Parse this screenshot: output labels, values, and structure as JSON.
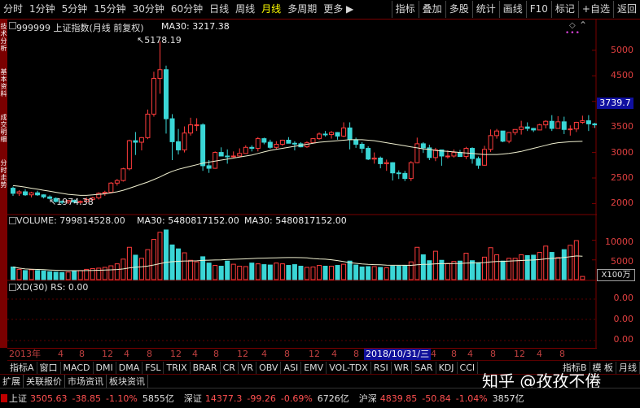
{
  "toolbar": {
    "periods": [
      "分时",
      "1分钟",
      "5分钟",
      "15分钟",
      "30分钟",
      "60分钟",
      "日线",
      "周线",
      "月线",
      "多周期",
      "更多 ▶"
    ],
    "active_period": "月线",
    "tools": [
      "指标",
      "叠加",
      "多股",
      "统计",
      "画线",
      "F10",
      "标记",
      "+自选",
      "返回"
    ]
  },
  "left_tabs": [
    "技术分析",
    "基本资料",
    "成交明细",
    "分时走势"
  ],
  "price_panel": {
    "title_code": "999999 上证指数(月线 前复权)",
    "ma_label": "MA30: 3217.38",
    "high_label": "5178.19",
    "low_label": "1974.38",
    "axis_labels": [
      "5000",
      "4500",
      "4000",
      "3500",
      "3000",
      "2500",
      "2000"
    ],
    "current_price": "3739.7",
    "colors": {
      "up": "#ff3c3c",
      "down": "#3ad6d6",
      "ma": "#f0f0d0"
    }
  },
  "volume_panel": {
    "title": "VOLUME: 799814528.00",
    "ma_label": "MA30: 5480817152.00",
    "ma_label2": "MA30: 5480817152.00",
    "axis_labels": [
      "10000",
      "5000"
    ],
    "unit": "X100万"
  },
  "xd_panel": {
    "title": "XD(30)  RS: 0.00",
    "axis_labels": [
      "0.00",
      "0.00",
      "0.00"
    ]
  },
  "time_axis": {
    "labels": [
      "2013年",
      "4",
      "8",
      "12",
      "4",
      "8",
      "12",
      "4",
      "8",
      "12",
      "4",
      "8",
      "12",
      "4",
      "8",
      "12",
      "4",
      "8",
      "",
      "4",
      "8",
      "12",
      "4",
      "8"
    ],
    "selected": "2018/10/31/三"
  },
  "indicators": [
    "指标A",
    "窗口",
    "MACD",
    "DMI",
    "DMA",
    "FSL",
    "TRIX",
    "BRAR",
    "CR",
    "VR",
    "OBV",
    "ASI",
    "EMV",
    "VOL-TDX",
    "RSI",
    "WR",
    "SAR",
    "KDJ",
    "CCI"
  ],
  "indicators_right": [
    "指标B",
    "模 板",
    "月线"
  ],
  "bottom_tabs": [
    "扩展",
    "关联报价",
    "市场资讯",
    "板块资讯"
  ],
  "watermark": "知乎 @孜孜不倦",
  "status": [
    {
      "name": "上证",
      "price": "3505.63",
      "chg": "-38.85",
      "pct": "-1.10%",
      "amt": "5855亿"
    },
    {
      "name": "深证",
      "price": "14377.3",
      "chg": "-99.26",
      "pct": "-0.69%",
      "amt": "6726亿"
    },
    {
      "name": "沪深",
      "price": "4839.85",
      "chg": "-50.84",
      "pct": "-1.04%",
      "amt": "3857亿"
    }
  ],
  "chart_data": {
    "type": "candlestick",
    "note_series": "monthly OHLC, Shanghai Composite",
    "ohlc": [
      [
        2300,
        2330,
        2150,
        2200
      ],
      [
        2200,
        2260,
        2150,
        2230
      ],
      [
        2230,
        2280,
        2150,
        2170
      ],
      [
        2170,
        2230,
        2120,
        2210
      ],
      [
        2210,
        2250,
        2150,
        2170
      ],
      [
        2170,
        2180,
        2100,
        2130
      ],
      [
        2130,
        2160,
        2080,
        2100
      ],
      [
        2100,
        2120,
        2020,
        2040
      ],
      [
        2040,
        2060,
        1990,
        2030
      ],
      [
        2030,
        2070,
        1990,
        2060
      ],
      [
        2060,
        2080,
        2000,
        2030
      ],
      [
        2030,
        2060,
        1990,
        2040
      ],
      [
        2040,
        2120,
        2000,
        2080
      ],
      [
        2080,
        2130,
        2050,
        2110
      ],
      [
        2110,
        2220,
        2080,
        2200
      ],
      [
        2200,
        2250,
        2150,
        2220
      ],
      [
        2220,
        2420,
        2200,
        2400
      ],
      [
        2400,
        2480,
        2350,
        2450
      ],
      [
        2450,
        2700,
        2430,
        2680
      ],
      [
        2680,
        3250,
        2650,
        3230
      ],
      [
        3230,
        3400,
        2950,
        3200
      ],
      [
        3200,
        3300,
        3040,
        3290
      ],
      [
        3290,
        3840,
        3260,
        3750
      ],
      [
        3750,
        4580,
        3700,
        4450
      ],
      [
        4450,
        5178,
        4150,
        4620
      ],
      [
        4620,
        4700,
        3370,
        3660
      ],
      [
        3660,
        3750,
        2850,
        3210
      ],
      [
        3210,
        3460,
        2960,
        3050
      ],
      [
        3050,
        3510,
        3000,
        3380
      ],
      [
        3380,
        3680,
        3330,
        3540
      ],
      [
        3540,
        3670,
        3420,
        3540
      ],
      [
        3540,
        3570,
        2640,
        2740
      ],
      [
        2740,
        2850,
        2600,
        2690
      ],
      [
        2690,
        3020,
        2680,
        3000
      ],
      [
        3000,
        3100,
        2950,
        2930
      ],
      [
        2930,
        3060,
        2780,
        2920
      ],
      [
        2920,
        3020,
        2900,
        2930
      ],
      [
        2930,
        3080,
        2920,
        2980
      ],
      [
        2980,
        3140,
        2980,
        3100
      ],
      [
        3100,
        3140,
        3020,
        3080
      ],
      [
        3080,
        3300,
        3020,
        3270
      ],
      [
        3270,
        3290,
        3160,
        3200
      ],
      [
        3200,
        3250,
        3070,
        3100
      ],
      [
        3100,
        3220,
        3060,
        3160
      ],
      [
        3160,
        3250,
        3130,
        3240
      ],
      [
        3240,
        3300,
        3200,
        3180
      ],
      [
        3180,
        3220,
        3040,
        3170
      ],
      [
        3170,
        3200,
        3100,
        3110
      ],
      [
        3110,
        3220,
        3090,
        3190
      ],
      [
        3190,
        3280,
        3180,
        3270
      ],
      [
        3270,
        3390,
        3250,
        3360
      ],
      [
        3360,
        3420,
        3310,
        3350
      ],
      [
        3350,
        3420,
        3270,
        3390
      ],
      [
        3390,
        3400,
        3250,
        3320
      ],
      [
        3320,
        3590,
        3300,
        3480
      ],
      [
        3480,
        3590,
        3060,
        3250
      ],
      [
        3250,
        3290,
        3090,
        3160
      ],
      [
        3160,
        3200,
        2990,
        3080
      ],
      [
        3080,
        3120,
        2850,
        2870
      ],
      [
        2870,
        3000,
        2780,
        2890
      ],
      [
        2890,
        2920,
        2690,
        2780
      ],
      [
        2780,
        2860,
        2640,
        2800
      ],
      [
        2800,
        2810,
        2450,
        2600
      ],
      [
        2600,
        2650,
        2480,
        2590
      ],
      [
        2590,
        2640,
        2440,
        2490
      ],
      [
        2490,
        2830,
        2440,
        2800
      ],
      [
        2800,
        3290,
        2790,
        3170
      ],
      [
        3170,
        3200,
        2990,
        3090
      ],
      [
        3090,
        3150,
        2850,
        2900
      ],
      [
        2900,
        3090,
        2830,
        3050
      ],
      [
        3050,
        3050,
        2740,
        2930
      ],
      [
        2930,
        3040,
        2880,
        2930
      ],
      [
        2930,
        3060,
        2900,
        3000
      ],
      [
        3000,
        3050,
        2920,
        2920
      ],
      [
        2920,
        3110,
        2870,
        3080
      ],
      [
        3080,
        3100,
        2780,
        2880
      ],
      [
        2880,
        2920,
        2680,
        2750
      ],
      [
        2750,
        3130,
        2740,
        3060
      ],
      [
        3060,
        3450,
        3010,
        3330
      ],
      [
        3330,
        3460,
        3270,
        3420
      ],
      [
        3420,
        3420,
        3200,
        3220
      ],
      [
        3220,
        3400,
        3180,
        3390
      ],
      [
        3390,
        3450,
        3340,
        3450
      ],
      [
        3450,
        3620,
        3350,
        3500
      ],
      [
        3500,
        3590,
        3420,
        3470
      ],
      [
        3470,
        3480,
        3400,
        3440
      ],
      [
        3440,
        3560,
        3440,
        3540
      ],
      [
        3540,
        3630,
        3470,
        3610
      ],
      [
        3610,
        3730,
        3420,
        3470
      ],
      [
        3470,
        3710,
        3530,
        3600
      ],
      [
        3600,
        3700,
        3360,
        3450
      ],
      [
        3450,
        3530,
        3330,
        3460
      ],
      [
        3460,
        3600,
        3400,
        3590
      ],
      [
        3590,
        3720,
        3560,
        3620
      ],
      [
        3620,
        3730,
        3420,
        3560
      ],
      [
        3560,
        3580,
        3480,
        3540
      ]
    ],
    "ma30": [
      2350,
      2340,
      2320,
      2300,
      2280,
      2260,
      2240,
      2220,
      2200,
      2180,
      2170,
      2160,
      2160,
      2170,
      2180,
      2190,
      2210,
      2230,
      2260,
      2300,
      2340,
      2380,
      2420,
      2470,
      2520,
      2580,
      2630,
      2670,
      2700,
      2730,
      2760,
      2790,
      2810,
      2830,
      2850,
      2870,
      2890,
      2910,
      2930,
      2950,
      2980,
      3010,
      3040,
      3060,
      3080,
      3100,
      3120,
      3140,
      3160,
      3180,
      3200,
      3210,
      3220,
      3230,
      3240,
      3250,
      3250,
      3250,
      3240,
      3230,
      3210,
      3190,
      3170,
      3150,
      3130,
      3110,
      3090,
      3070,
      3060,
      3040,
      3030,
      3020,
      3010,
      3000,
      2990,
      2980,
      2970,
      2960,
      2960,
      2960,
      2970,
      2980,
      3000,
      3020,
      3050,
      3080,
      3110,
      3140,
      3170,
      3190,
      3200,
      3210,
      3215,
      3217
    ],
    "volume": [
      3200,
      2600,
      2300,
      2500,
      2300,
      2200,
      2000,
      1900,
      1800,
      1900,
      2200,
      2300,
      2600,
      2800,
      2900,
      3100,
      3500,
      4000,
      5200,
      8200,
      6200,
      5400,
      7600,
      10200,
      12000,
      12600,
      8800,
      7800,
      6800,
      4900,
      4500,
      5800,
      4200,
      3600,
      3400,
      4700,
      3900,
      3400,
      3300,
      4200,
      4000,
      3800,
      3700,
      4200,
      4000,
      3600,
      3800,
      3400,
      3100,
      3200,
      3600,
      3400,
      3400,
      3600,
      3900,
      4700,
      3700,
      3200,
      3300,
      3300,
      3100,
      3000,
      3400,
      3400,
      3500,
      4500,
      8200,
      6300,
      4800,
      7200,
      4900,
      4100,
      4600,
      4700,
      6700,
      4800,
      4300,
      5700,
      8100,
      6300,
      4700,
      5400,
      5400,
      6300,
      6100,
      6200,
      6900,
      8500,
      6900,
      5600,
      7600,
      8700,
      9900,
      800
    ],
    "ylim_price": [
      1800,
      5300
    ],
    "ylim_volume": [
      0,
      13000
    ]
  }
}
